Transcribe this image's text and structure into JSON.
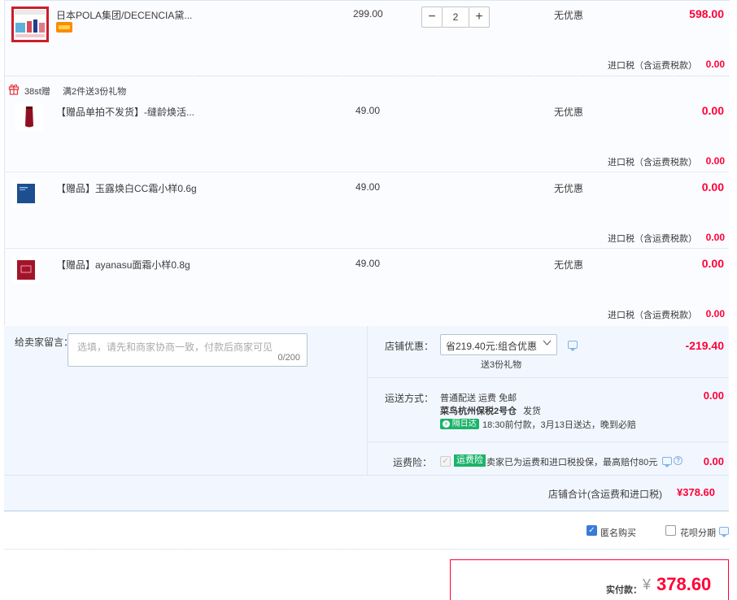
{
  "items": [
    {
      "name": "日本POLA集团/DECENCIA黛...",
      "thumb_icon": "pola-product-box-thumbnail",
      "badge_icon": "card-icon",
      "price": "299.00",
      "quantity": "2",
      "promo": "无优惠",
      "amount": "598.00",
      "tax_label": "进口税（含运费税款）",
      "tax_value": "0.00"
    }
  ],
  "gift_header": {
    "icon": "gift-icon",
    "tag": "38st赠",
    "text": "满2件送3份礼物"
  },
  "gifts": [
    {
      "name": "【赠品单拍不发货】-缝龄焕活...",
      "thumb_icon": "red-tube-thumbnail",
      "price": "49.00",
      "promo": "无优惠",
      "amount": "0.00",
      "tax_label": "进口税（含运费税款）",
      "tax_value": "0.00"
    },
    {
      "name": "【赠品】玉露焕白CC霜小样0.6g",
      "thumb_icon": "blue-sachet-thumbnail",
      "price": "49.00",
      "promo": "无优惠",
      "amount": "0.00",
      "tax_label": "进口税（含运费税款）",
      "tax_value": "0.00"
    },
    {
      "name": "【赠品】ayanasu面霜小样0.8g",
      "thumb_icon": "red-sachet-thumbnail",
      "price": "49.00",
      "promo": "无优惠",
      "amount": "0.00",
      "tax_label": "进口税（含运费税款）",
      "tax_value": "0.00"
    }
  ],
  "message": {
    "label": "给卖家留言：",
    "placeholder": "选填，请先和商家协商一致，付款后商家可见",
    "counter": "0/200"
  },
  "shop_discount": {
    "label": "店铺优惠：",
    "selected": "省219.40元:组合优惠",
    "gift_note": "送3份礼物",
    "amount": "-219.40"
  },
  "shipping": {
    "label": "运送方式：",
    "line1": "普通配送 运费 免邮",
    "warehouse": "菜鸟杭州保税2号仓",
    "dispatch": "发货",
    "badge": "隔日达",
    "eta": "18:30前付款，3月13日送达，晚到必赔",
    "amount": "0.00"
  },
  "insurance": {
    "label": "运费险：",
    "badge": "运费险",
    "text": "卖家已为运费和进口税投保，最高赔付80元",
    "amount": "0.00"
  },
  "shop_total": {
    "label": "店铺合计(含运费和进口税)",
    "value": "¥378.60"
  },
  "options": {
    "anonymous_label": "匿名购买",
    "anonymous_checked": true,
    "huabei_label": "花呗分期",
    "huabei_checked": false
  },
  "payment": {
    "label": "实付款：",
    "currency": "¥",
    "value": "378.60"
  },
  "colors": {
    "accent_red": "#ff0036",
    "panel_blue": "#f2f7ff",
    "green_badge": "#1bb36a"
  }
}
